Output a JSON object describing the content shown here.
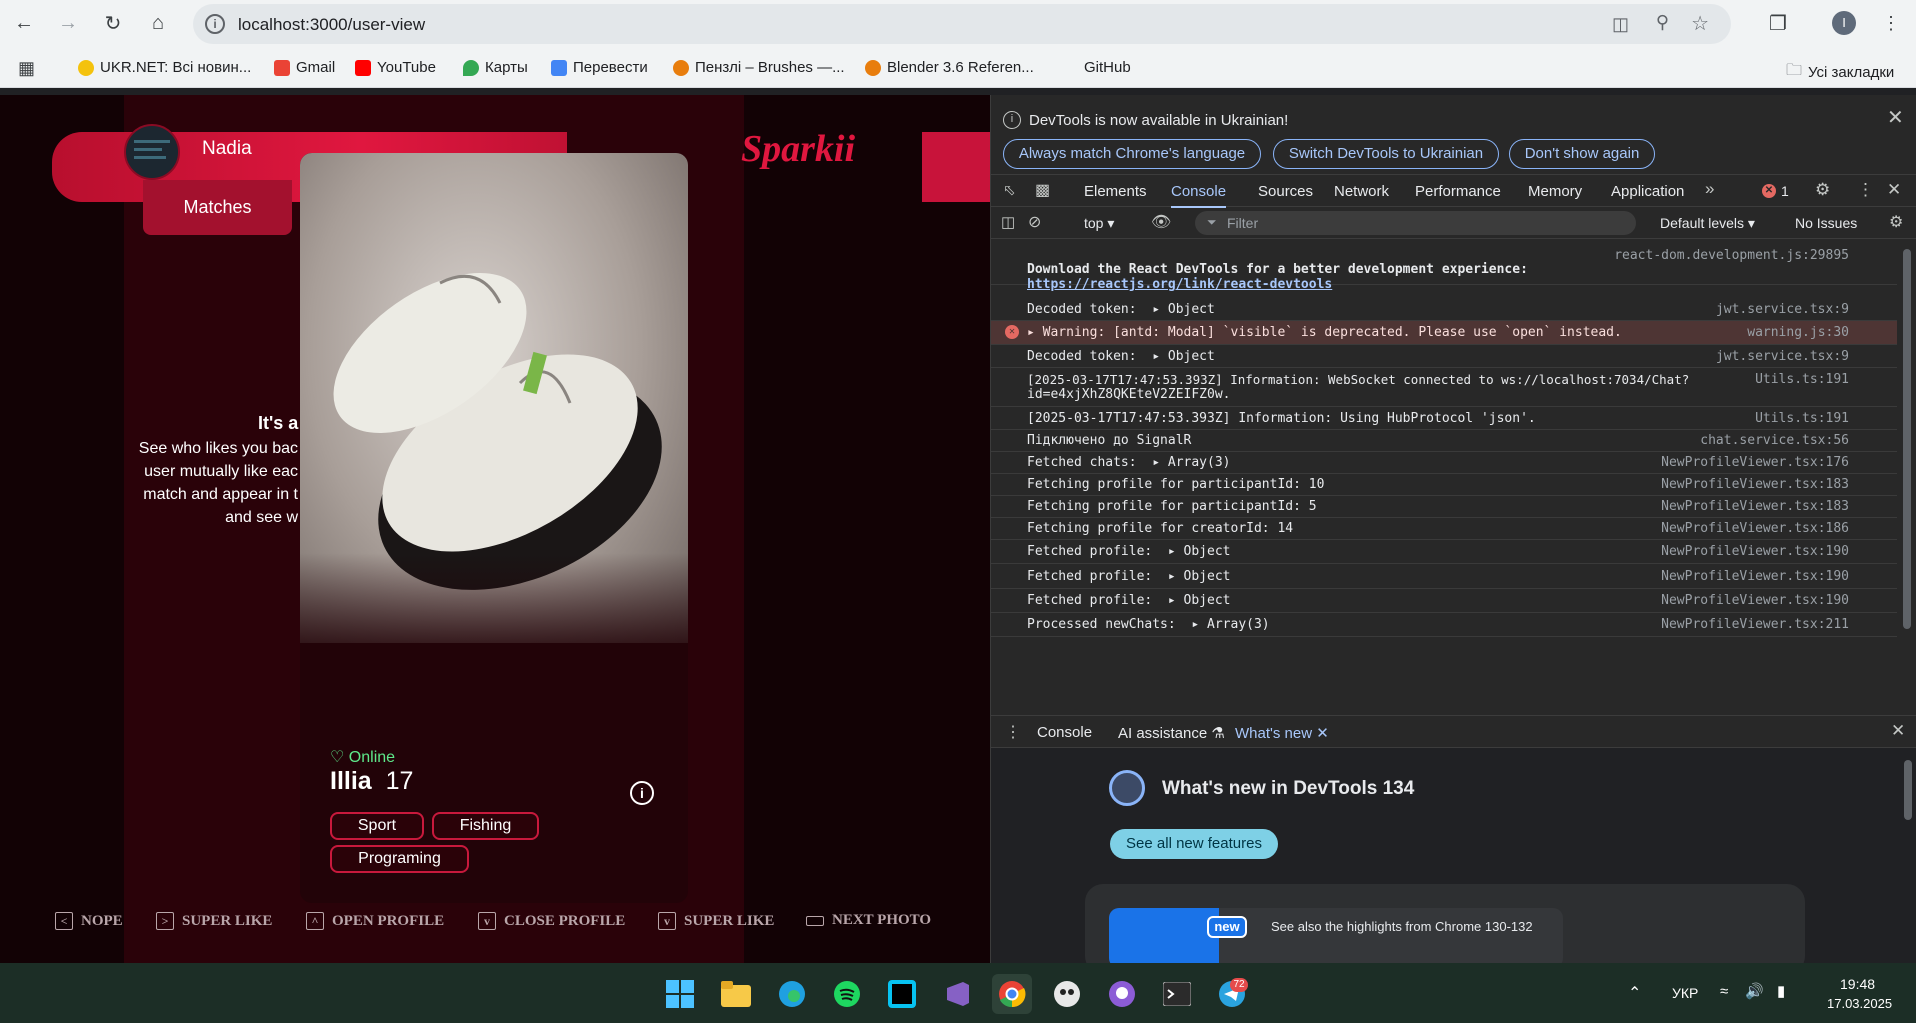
{
  "browser": {
    "url": "localhost:3000/user-view",
    "profile_initial": "I",
    "bookmarks": [
      "UKR.NET: Всі новин...",
      "Gmail",
      "YouTube",
      "Карты",
      "Перевести",
      "Пензлі – Brushes —...",
      "Blender 3.6 Referen...",
      "GitHub"
    ],
    "all_bookmarks": "Усі закладки"
  },
  "app": {
    "user_name": "Nadia",
    "logo": "Sparkii",
    "tab_matches": "Matches",
    "promo_title": "It's a",
    "promo_lines": [
      "See who likes you bac",
      "user mutually like eac",
      "match and appear in t",
      "and see w"
    ],
    "card": {
      "status": "Online",
      "name": "Illia",
      "age": "17",
      "tags": [
        "Sport",
        "Fishing",
        "Programing"
      ]
    },
    "hints": [
      "NOPE",
      "SUPER LIKE",
      "OPEN PROFILE",
      "CLOSE PROFILE",
      "SUPER LIKE",
      "NEXT PHOTO"
    ]
  },
  "devtools": {
    "banner": "DevTools is now available in Ukrainian!",
    "banner_buttons": [
      "Always match Chrome's language",
      "Switch DevTools to Ukrainian",
      "Don't show again"
    ],
    "tabs": [
      "Elements",
      "Console",
      "Sources",
      "Network",
      "Performance",
      "Memory",
      "Application"
    ],
    "error_count": "1",
    "context": "top",
    "filter_placeholder": "Filter",
    "levels": "Default levels",
    "issues": "No Issues",
    "logs": [
      {
        "msg": "Download the React DevTools for a better development experience:",
        "link": "https://reactjs.org/link/react-devtools",
        "src": "react-dom.development.js:29895"
      },
      {
        "msg": "Decoded token:  ▸ Object",
        "src": "jwt.service.tsx:9"
      },
      {
        "msg": "▸ Warning: [antd: Modal] `visible` is deprecated. Please use `open` instead.",
        "src": "warning.js:30"
      },
      {
        "msg": "Decoded token:  ▸ Object",
        "src": "jwt.service.tsx:9"
      },
      {
        "msg": "[2025-03-17T17:47:53.393Z] Information: WebSocket connected to ws://localhost:7034/Chat?",
        "msg2": "id=e4xjXhZ8QKEteV2ZEIFZ0w.",
        "src": "Utils.ts:191"
      },
      {
        "msg": "[2025-03-17T17:47:53.393Z] Information: Using HubProtocol 'json'.",
        "src": "Utils.ts:191"
      },
      {
        "msg": "Підключено до SignalR",
        "src": "chat.service.tsx:56"
      },
      {
        "msg": "Fetched chats:  ▸ Array(3)",
        "src": "NewProfileViewer.tsx:176"
      },
      {
        "msg": "Fetching profile for participantId: 10",
        "src": "NewProfileViewer.tsx:183"
      },
      {
        "msg": "Fetching profile for participantId: 5",
        "src": "NewProfileViewer.tsx:183"
      },
      {
        "msg": "Fetching profile for creatorId: 14",
        "src": "NewProfileViewer.tsx:186"
      },
      {
        "msg": "Fetched profile:  ▸ Object",
        "src": "NewProfileViewer.tsx:190"
      },
      {
        "msg": "Fetched profile:  ▸ Object",
        "src": "NewProfileViewer.tsx:190"
      },
      {
        "msg": "Fetched profile:  ▸ Object",
        "src": "NewProfileViewer.tsx:190"
      },
      {
        "msg": "Processed newChats:  ▸ Array(3)",
        "src": "NewProfileViewer.tsx:211"
      }
    ],
    "drawer_tabs": [
      "Console",
      "AI assistance",
      "What's new"
    ],
    "whats_new_title": "What's new in DevTools 134",
    "see_all": "See all new features",
    "new_badge": "new",
    "highlights": "See also the highlights from Chrome 130-132"
  },
  "taskbar": {
    "lang": "УКР",
    "time": "19:48",
    "date": "17.03.2025",
    "telegram_badge": "72"
  }
}
